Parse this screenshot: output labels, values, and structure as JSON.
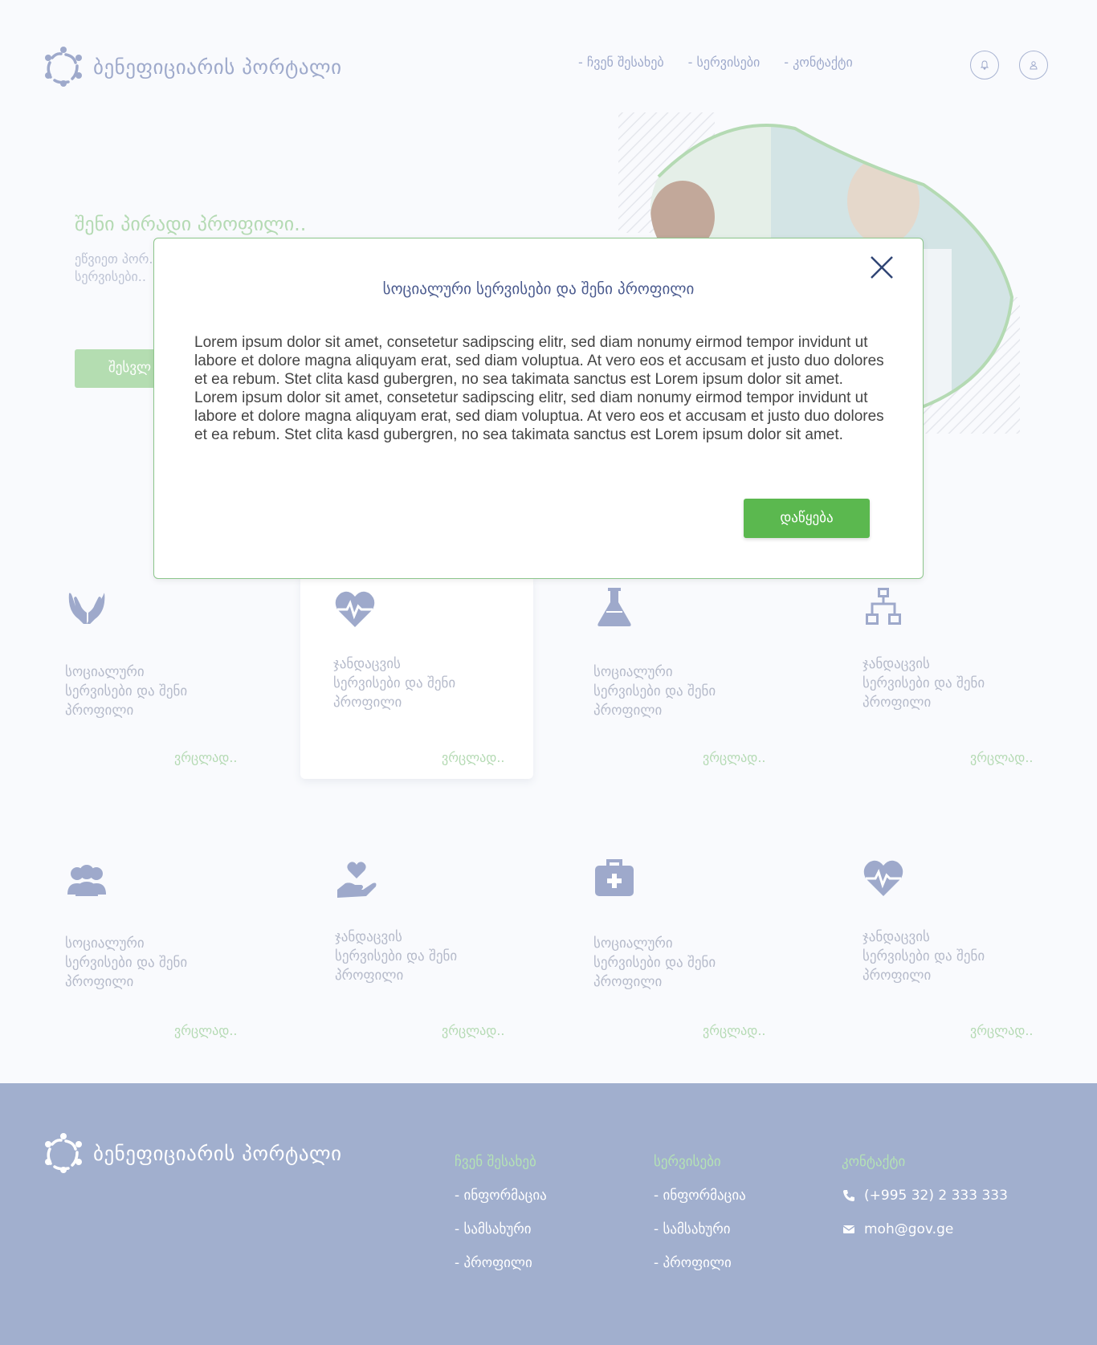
{
  "header": {
    "logo_text": "ბენეფიციარის პორტალი",
    "nav": [
      "- ჩვენ შესახებ",
      "- სერვისები",
      "- კონტაქტი"
    ]
  },
  "hero": {
    "title": "შენი პირადი პროფილი..",
    "desc": "ეწვიეთ პორ... მიიღეთ სრ... სერვისები..",
    "button": "შესვლ"
  },
  "modal": {
    "title": "სოციალური სერვისები და შენი პროფილი",
    "body": "Lorem ipsum dolor sit amet, consetetur sadipscing elitr, sed diam nonumy eirmod tempor invidunt ut labore et dolore magna aliquyam erat, sed diam voluptua. At vero eos et accusam et justo duo dolores et ea rebum. Stet clita kasd gubergren, no sea takimata sanctus est Lorem ipsum dolor sit amet. Lorem ipsum dolor sit amet, consetetur sadipscing elitr, sed diam nonumy eirmod tempor invidunt ut labore et dolore magna aliquyam erat, sed diam voluptua. At vero eos et accusam et justo duo dolores et ea rebum. Stet clita kasd gubergren, no sea takimata sanctus est Lorem ipsum dolor sit amet.",
    "button": "დაწყება"
  },
  "cards": [
    {
      "icon": "hands-icon",
      "text": "სოციალური სერვისები და შენი პროფილი",
      "more": "ვრცლად.."
    },
    {
      "icon": "heartbeat-icon",
      "text": "ჯანდაცვის სერვისები და შენი პროფილი",
      "more": "ვრცლად.."
    },
    {
      "icon": "flask-icon",
      "text": "სოციალური სერვისები და შენი პროფილი",
      "more": "ვრცლად.."
    },
    {
      "icon": "network-icon",
      "text": "ჯანდაცვის სერვისები და შენი პროფილი",
      "more": "ვრცლად.."
    },
    {
      "icon": "users-icon",
      "text": "სოციალური სერვისები და შენი პროფილი",
      "more": "ვრცლად.."
    },
    {
      "icon": "hand-heart-icon",
      "text": "ჯანდაცვის სერვისები და შენი პროფილი",
      "more": "ვრცლად.."
    },
    {
      "icon": "first-aid-icon",
      "text": "სოციალური სერვისები და შენი პროფილი",
      "more": "ვრცლად.."
    },
    {
      "icon": "heartbeat-icon",
      "text": "ჯანდაცვის სერვისები და შენი პროფილი",
      "more": "ვრცლად.."
    }
  ],
  "footer": {
    "logo_text": "ბენეფიციარის პორტალი",
    "about": {
      "title": "ჩვენ შესახებ",
      "items": [
        "- ინფორმაცია",
        "- სამსახური",
        "- პროფილი"
      ]
    },
    "services": {
      "title": "სერვისები",
      "items": [
        "- ინფორმაცია",
        "- სამსახური",
        "- პროფილი"
      ]
    },
    "contact": {
      "title": "კონტაქტი",
      "phone": "(+995 32) 2 333 333",
      "email": "moh@gov.ge"
    }
  }
}
